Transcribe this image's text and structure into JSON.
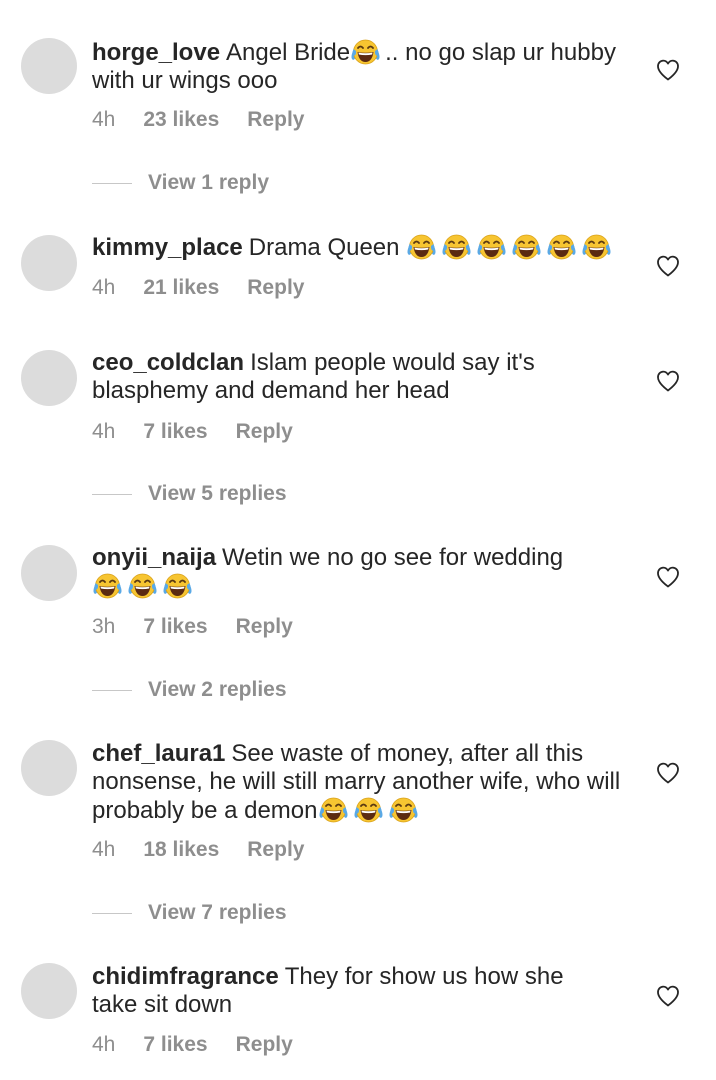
{
  "comments": [
    {
      "username": "horge_love",
      "text_before": "Angel Bride",
      "emoji_count": 1,
      "text_after": ".. no go slap ur hubby with ur wings ooo",
      "time": "4h",
      "likes": "23 likes",
      "reply": "Reply",
      "view_replies": "View 1 reply"
    },
    {
      "username": "kimmy_place",
      "text_before": "Drama Queen",
      "emoji_count": 6,
      "text_after": "",
      "time": "4h",
      "likes": "21 likes",
      "reply": "Reply",
      "view_replies": ""
    },
    {
      "username": "ceo_coldclan",
      "text_before": "Islam people would say it's blasphemy and demand her head",
      "emoji_count": 0,
      "text_after": "",
      "time": "4h",
      "likes": "7 likes",
      "reply": "Reply",
      "view_replies": "View 5 replies"
    },
    {
      "username": "onyii_naija",
      "text_before": "Wetin we no go see for wedding",
      "emoji_count": 3,
      "text_after": "",
      "time": "3h",
      "likes": "7 likes",
      "reply": "Reply",
      "view_replies": "View 2 replies"
    },
    {
      "username": "chef_laura1",
      "text_before": "See waste of money, after all this nonsense, he will still marry another wife, who will probably be a demon",
      "emoji_count": 3,
      "text_after": "",
      "time": "4h",
      "likes": "18 likes",
      "reply": "Reply",
      "view_replies": "View 7 replies"
    },
    {
      "username": "chidimfragrance",
      "text_before": "They for show us how she take sit down",
      "emoji_count": 0,
      "text_after": "",
      "time": "4h",
      "likes": "7 likes",
      "reply": "Reply",
      "view_replies": ""
    }
  ],
  "icons": {
    "emoji": "face-with-tears-of-joy-icon",
    "like": "heart-outline-icon"
  },
  "colors": {
    "text": "#262626",
    "secondary": "#8e8e8e",
    "avatar": "#dcdcdc",
    "emoji_face": "#f7c531",
    "emoji_tear": "#5aa9e6"
  }
}
